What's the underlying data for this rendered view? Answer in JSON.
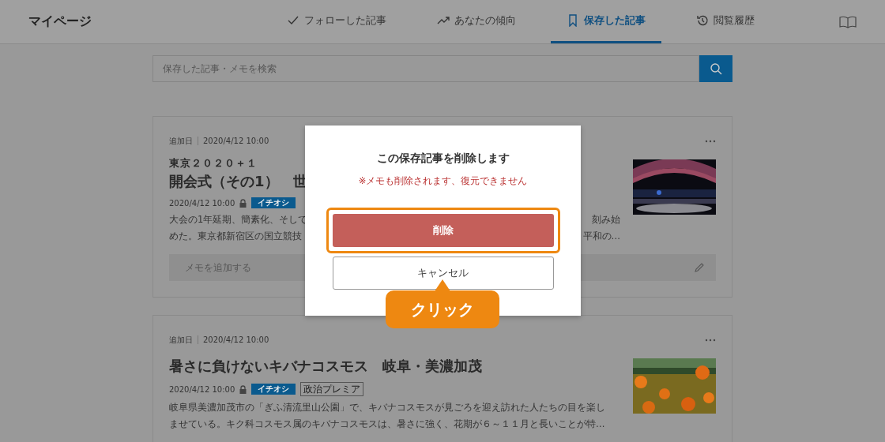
{
  "header": {
    "title": "マイページ",
    "tabs": [
      {
        "label": "フォローした記事",
        "selected": false
      },
      {
        "label": "あなたの傾向",
        "selected": false
      },
      {
        "label": "保存した記事",
        "selected": true
      },
      {
        "label": "閲覧履歴",
        "selected": false
      }
    ]
  },
  "search": {
    "placeholder": "保存した記事・メモを検索"
  },
  "articles": [
    {
      "added_label": "追加日",
      "added_date": "2020/4/12 10:00",
      "kicker": "東京２０２０＋１",
      "title": "開会式（その1）　世",
      "date": "2020/4/12 10:00",
      "locked": true,
      "tags": [
        {
          "label": "イチオシ",
          "kind": "filled"
        }
      ],
      "summary": [
        {
          "text": "大会の1年延期、簡素化、そして",
          "tail": "刻み始"
        },
        {
          "text": "めた。東京都新宿区の国立競技",
          "tail": "平和の…"
        }
      ],
      "memo": {
        "placeholder": "メモを追加する"
      }
    },
    {
      "added_label": "追加日",
      "added_date": "2020/4/12 10:00",
      "title": "暑さに負けないキバナコスモス　岐阜・美濃加茂",
      "date": "2020/4/12 10:00",
      "locked": true,
      "tags": [
        {
          "label": "イチオシ",
          "kind": "filled"
        },
        {
          "label": "政治プレミア",
          "kind": "outline"
        }
      ],
      "summary": [
        {
          "text": "岐阜県美濃加茂市の「ぎふ清流里山公園」で、キバナコスモスが見ごろを迎え訪れた人たちの目を楽し"
        },
        {
          "text": "ませている。キク科コスモス属のキバナコスモスは、暑さに強く、花期が６～１１月と長いことが特…"
        }
      ]
    }
  ],
  "dialog": {
    "title": "この保存記事を削除します",
    "note": "※メモも削除されます、復元できません",
    "confirm": {
      "label": "削除",
      "highlighted": true
    },
    "cancel": "キャンセル"
  },
  "callout": {
    "label": "クリック"
  }
}
